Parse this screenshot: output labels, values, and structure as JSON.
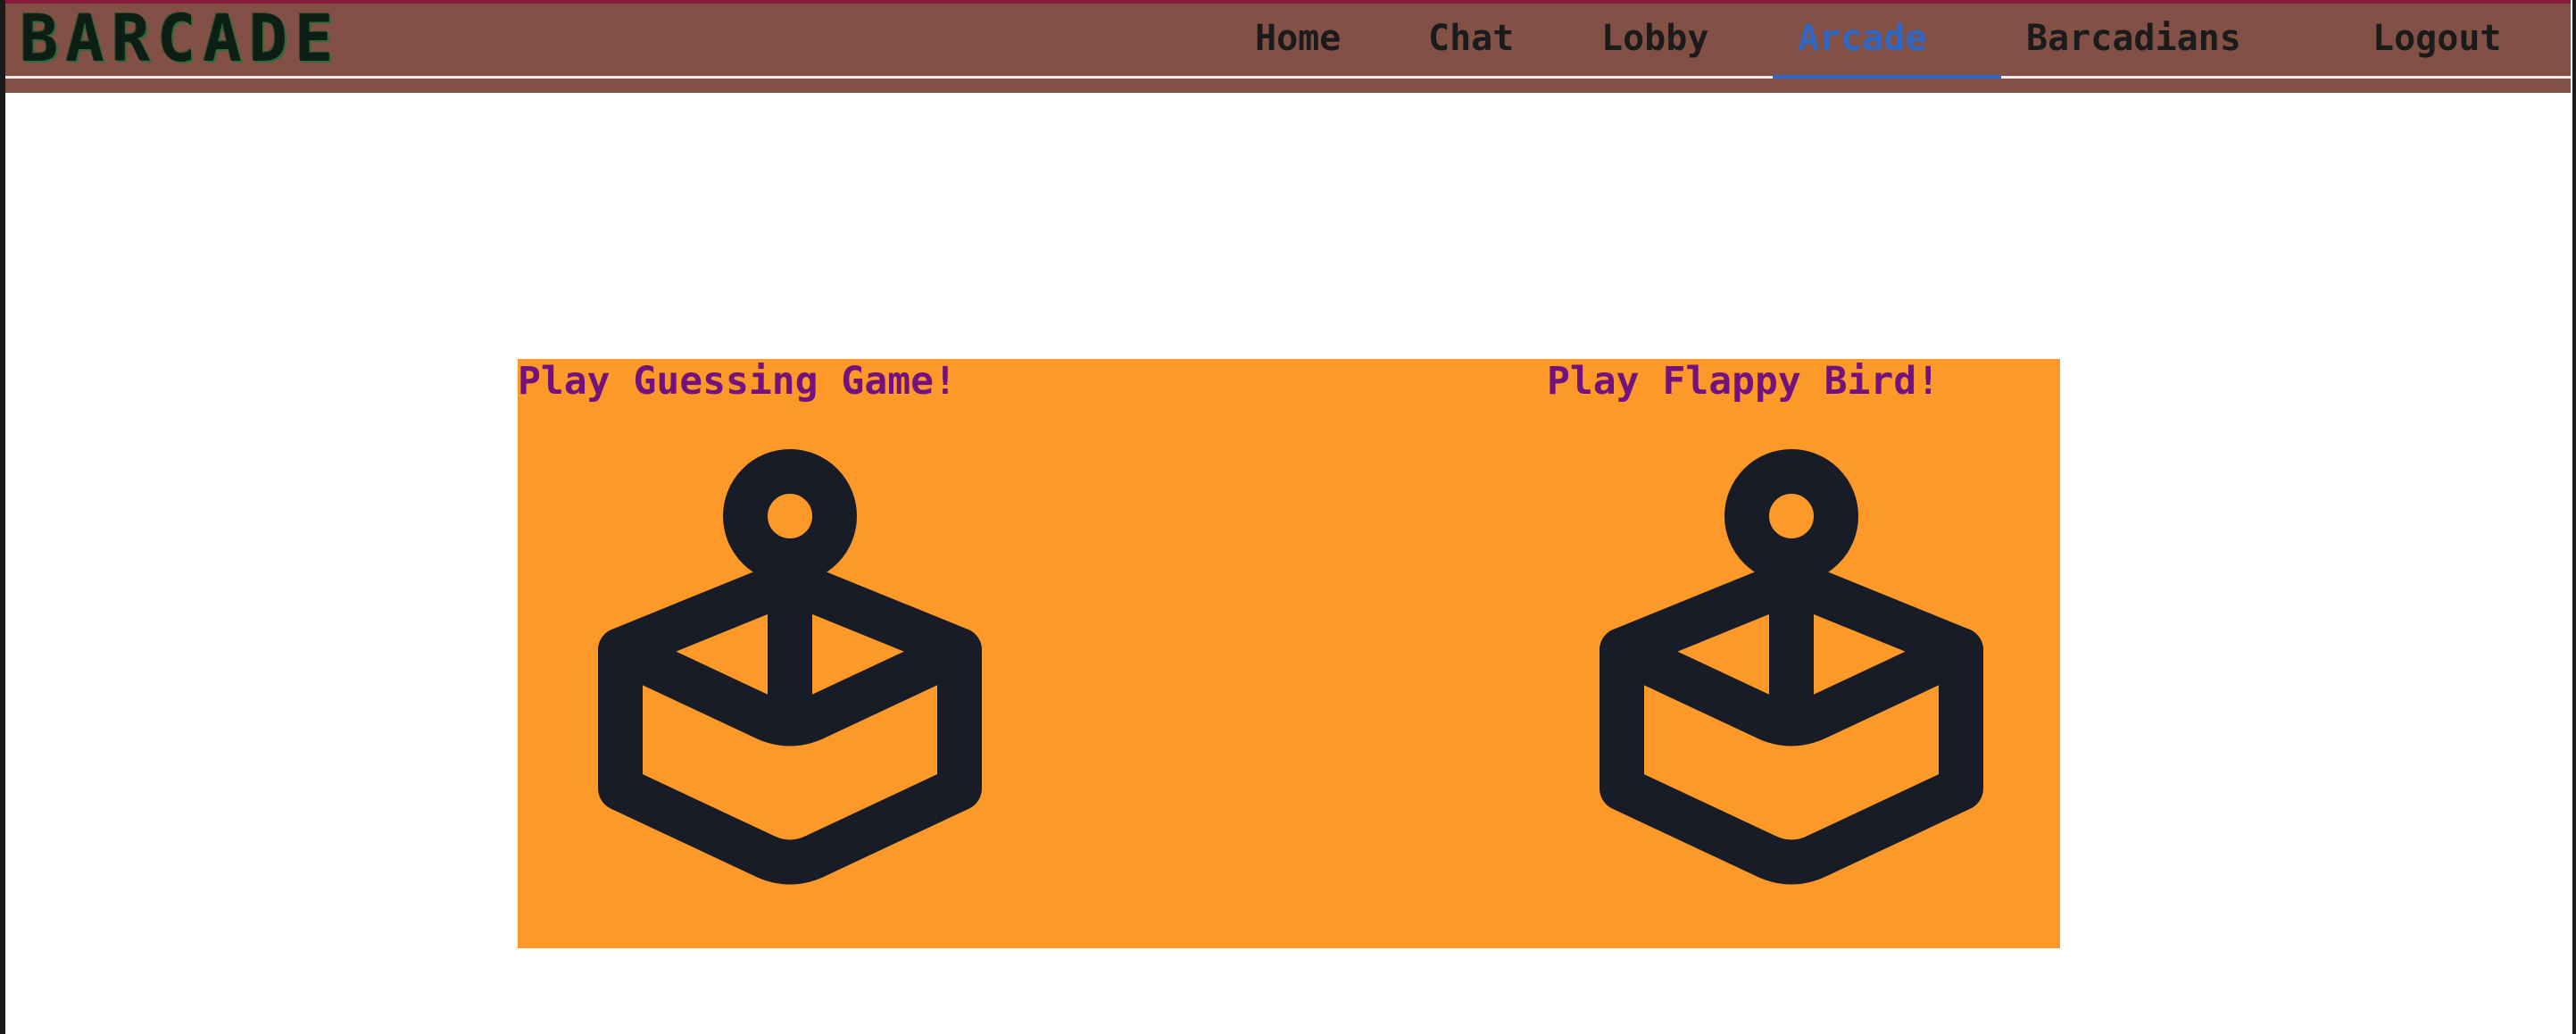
{
  "header": {
    "logo_text": "BARCADE",
    "nav": [
      {
        "label": "Home",
        "active": false
      },
      {
        "label": "Chat",
        "active": false
      },
      {
        "label": "Lobby",
        "active": false
      },
      {
        "label": "Arcade",
        "active": true
      },
      {
        "label": "Barcadians",
        "active": false
      },
      {
        "label": "Logout",
        "active": false
      }
    ]
  },
  "games": [
    {
      "label": "Play Guessing Game!",
      "icon": "joystick-icon"
    },
    {
      "label": "Play Flappy Bird!",
      "icon": "joystick-icon"
    }
  ],
  "colors": {
    "header_bg": "#835045",
    "panel_bg": "#fd9929",
    "game_label": "#73127f",
    "active_nav": "#2f67c4",
    "icon": "#181c26"
  }
}
